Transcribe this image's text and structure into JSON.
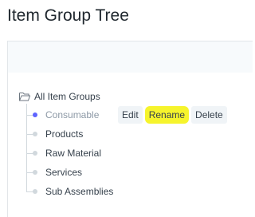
{
  "page": {
    "title": "Item Group Tree"
  },
  "tree": {
    "root_label": "All Item Groups",
    "nodes": [
      {
        "label": "Consumable",
        "selected": true
      },
      {
        "label": "Products",
        "selected": false
      },
      {
        "label": "Raw Material",
        "selected": false
      },
      {
        "label": "Services",
        "selected": false
      },
      {
        "label": "Sub Assemblies",
        "selected": false
      }
    ]
  },
  "node_actions": {
    "edit_label": "Edit",
    "rename_label": "Rename",
    "delete_label": "Delete"
  },
  "colors": {
    "selected_dot": "#5e64ff",
    "highlight": "#f6f42c"
  }
}
